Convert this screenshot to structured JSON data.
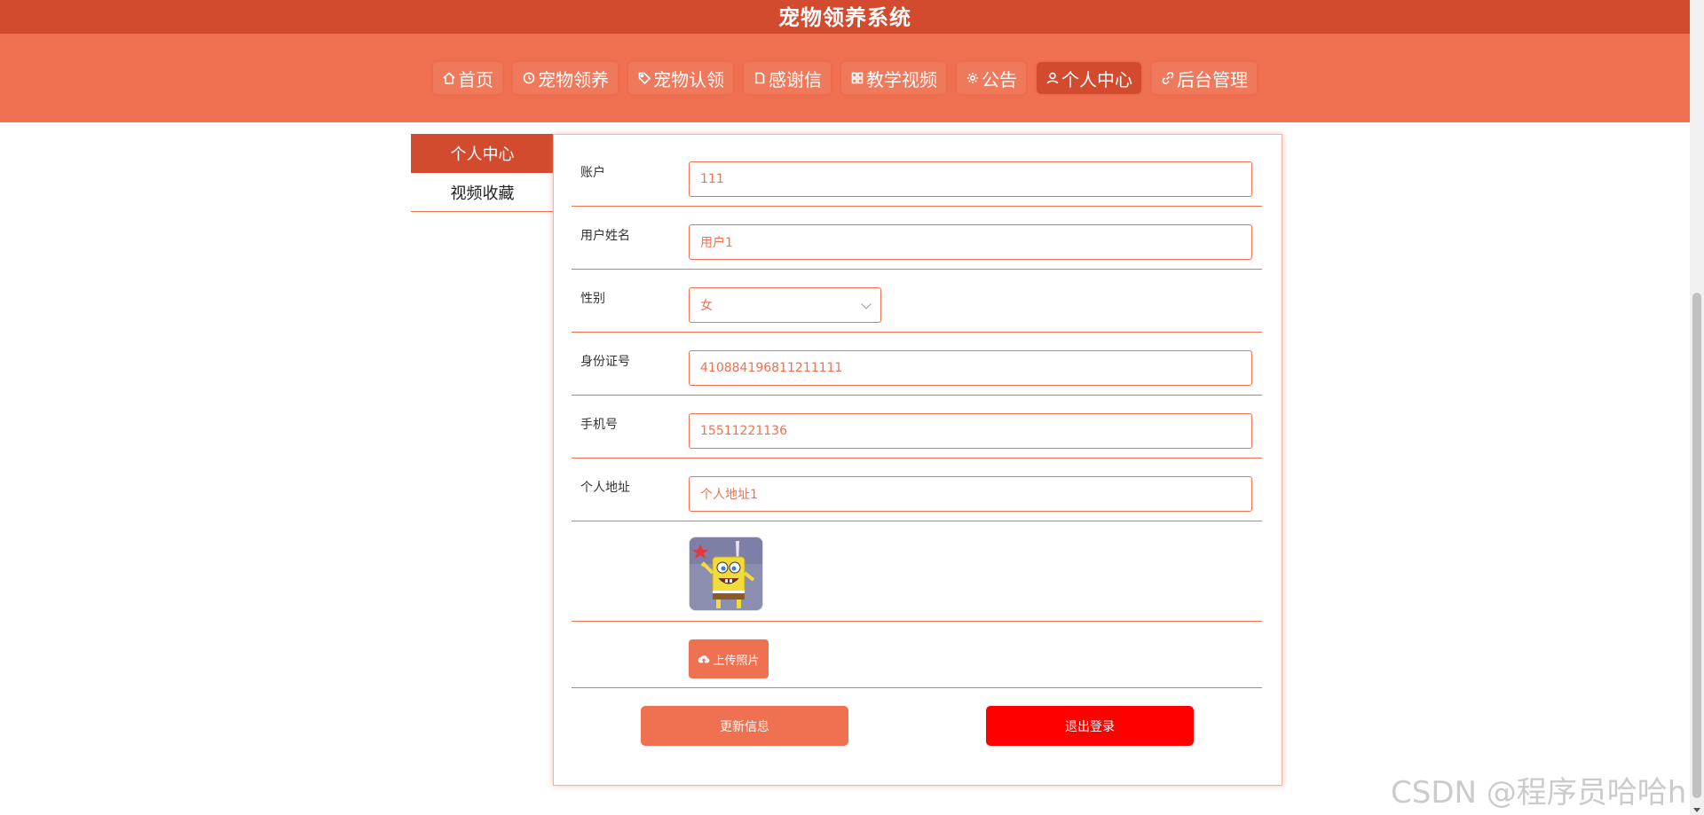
{
  "header": {
    "title": "宠物领养系统"
  },
  "nav": {
    "items": [
      {
        "label": "首页",
        "icon": "home-icon"
      },
      {
        "label": "宠物领养",
        "icon": "clock-icon"
      },
      {
        "label": "宠物认领",
        "icon": "tag-icon"
      },
      {
        "label": "感谢信",
        "icon": "document-icon"
      },
      {
        "label": "教学视频",
        "icon": "grid-icon"
      },
      {
        "label": "公告",
        "icon": "gear-icon"
      },
      {
        "label": "个人中心",
        "icon": "user-icon",
        "active": true
      },
      {
        "label": "后台管理",
        "icon": "link-icon"
      }
    ],
    "active_color": "#d24b2f"
  },
  "sidebar": {
    "items": [
      {
        "label": "个人中心",
        "active": true
      },
      {
        "label": "视频收藏",
        "active": false
      }
    ]
  },
  "form": {
    "account": {
      "label": "账户",
      "value": "111"
    },
    "name": {
      "label": "用户姓名",
      "value": "用户1"
    },
    "gender": {
      "label": "性别",
      "value": "女"
    },
    "id_number": {
      "label": "身份证号",
      "value": "410884196811211111"
    },
    "phone": {
      "label": "手机号",
      "value": "15511221136"
    },
    "address": {
      "label": "个人地址",
      "value": "个人地址1"
    },
    "upload_label": "上传照片",
    "update_label": "更新信息",
    "logout_label": "退出登录"
  },
  "watermark": "CSDN @程序员哈哈h",
  "colors": {
    "primary": "#f07152",
    "header": "#d24b2f",
    "danger": "#ff0000"
  }
}
